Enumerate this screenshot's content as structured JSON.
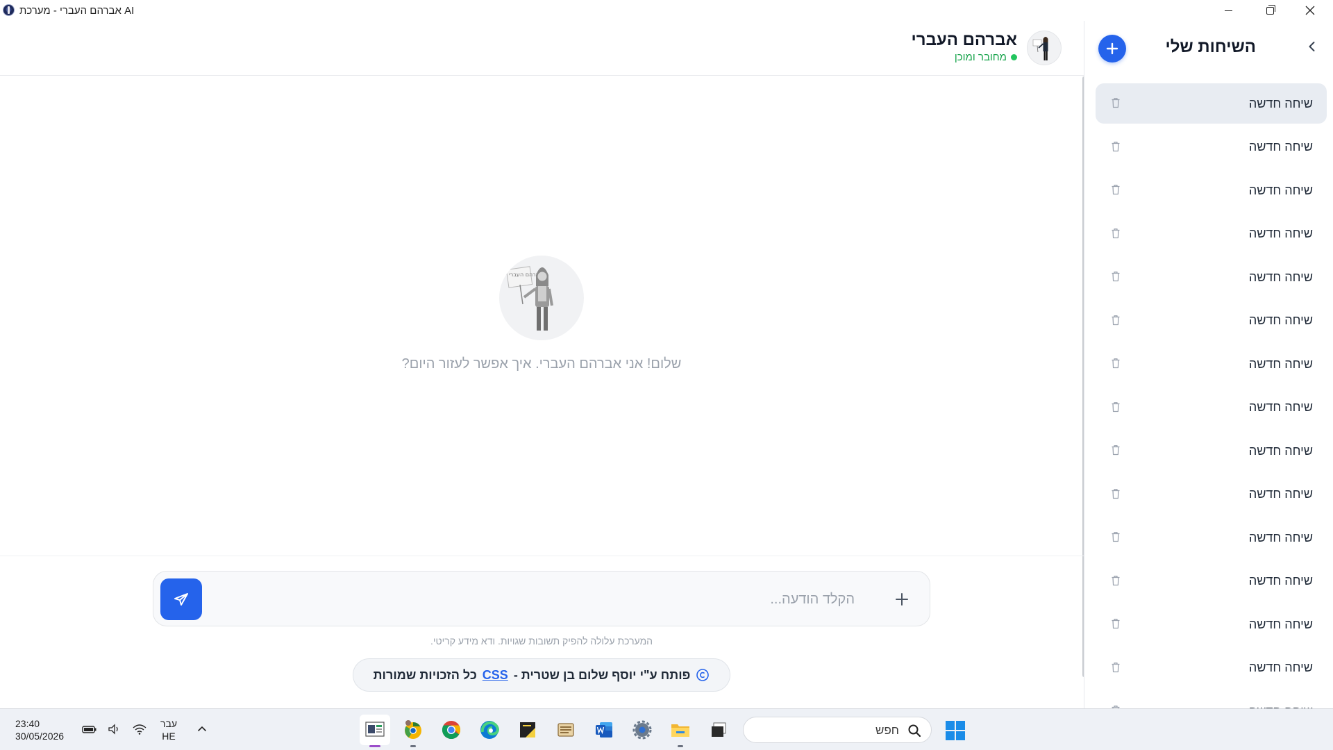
{
  "window": {
    "title": "אברהם העברי - מערכת AI"
  },
  "sidebar": {
    "title": "השיחות שלי",
    "items": [
      {
        "label": "שיחה חדשה",
        "active": true
      },
      {
        "label": "שיחה חדשה",
        "active": false
      },
      {
        "label": "שיחה חדשה",
        "active": false
      },
      {
        "label": "שיחה חדשה",
        "active": false
      },
      {
        "label": "שיחה חדשה",
        "active": false
      },
      {
        "label": "שיחה חדשה",
        "active": false
      },
      {
        "label": "שיחה חדשה",
        "active": false
      },
      {
        "label": "שיחה חדשה",
        "active": false
      },
      {
        "label": "שיחה חדשה",
        "active": false
      },
      {
        "label": "שיחה חדשה",
        "active": false
      },
      {
        "label": "שיחה חדשה",
        "active": false
      },
      {
        "label": "שיחה חדשה",
        "active": false
      },
      {
        "label": "שיחה חדשה",
        "active": false
      },
      {
        "label": "שיחה חדשה",
        "active": false
      },
      {
        "label": "שיחה חדשה",
        "active": false
      }
    ]
  },
  "header": {
    "name": "אברהם העברי",
    "status": "מחובר ומוכן"
  },
  "welcome": {
    "avatar_sign_text": "אברהם העברי",
    "message": "שלום! אני אברהם העברי. איך אפשר לעזור היום?"
  },
  "composer": {
    "placeholder": "הקלד הודעה...",
    "value": ""
  },
  "disclaimer": "המערכת עלולה להפיק תשובות שגויות. ודא מידע קריטי.",
  "credit": {
    "prefix": "פותח ע\"י יוסף שלום בן שטרית -",
    "link": "CSS",
    "suffix": "כל הזכויות שמורות"
  },
  "taskbar": {
    "time": "23:40",
    "date": "30/05/2026",
    "lang_top": "עבר",
    "lang_bottom": "HE",
    "search_placeholder": "חפש",
    "apps": [
      "ai-app-icon",
      "chrome-canary-icon",
      "chrome-icon",
      "edge-icon",
      "sticky-notes-icon",
      "scroll-app-icon",
      "word-icon",
      "settings-icon",
      "file-explorer-icon",
      "terminal-icon"
    ]
  },
  "colors": {
    "accent": "#2563eb",
    "status_green": "#22c55e",
    "active_item_bg": "#e8ecf2"
  }
}
